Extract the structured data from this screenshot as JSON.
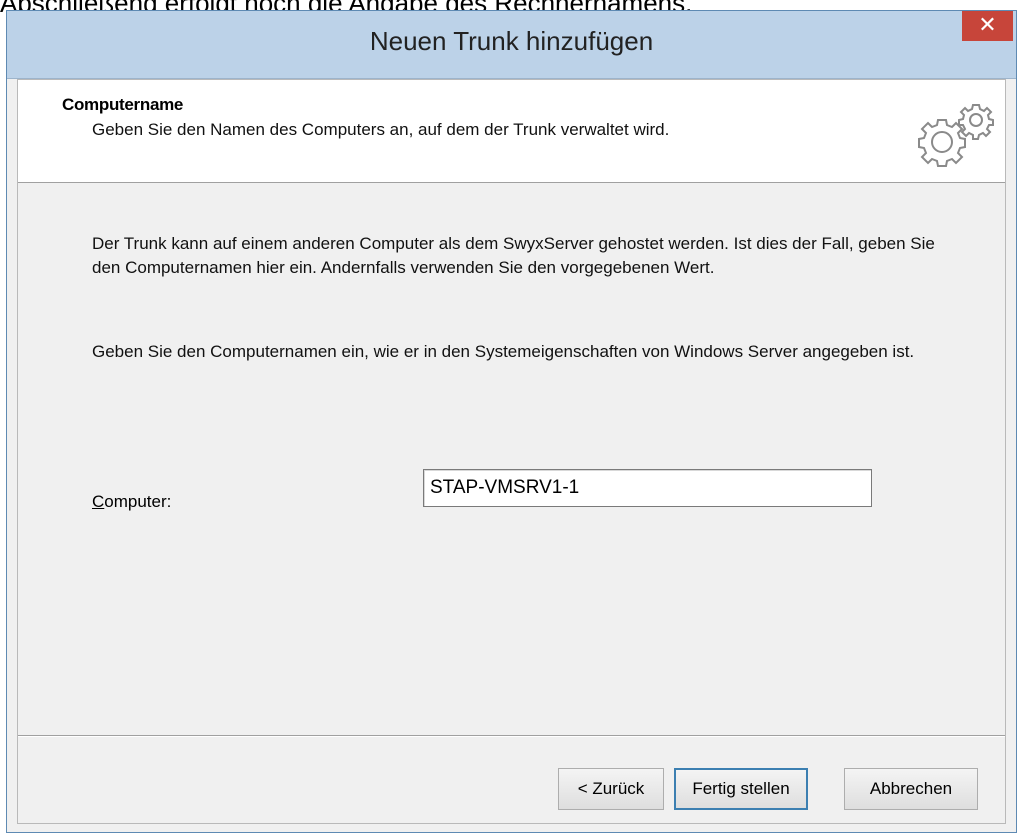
{
  "caption": "Abschließend erfolgt noch die Angabe des Rechnernamens.",
  "window": {
    "title": "Neuen Trunk hinzufügen",
    "close_glyph": "✕"
  },
  "header": {
    "title": "Computername",
    "subtitle": "Geben Sie den Namen des Computers an, auf dem der Trunk verwaltet wird.",
    "icon": "gears-icon"
  },
  "body": {
    "paragraph1": "Der Trunk kann auf einem anderen Computer als dem SwyxServer gehostet werden. Ist dies der Fall, geben Sie den Computernamen hier ein. Andernfalls verwenden Sie den vorgegebenen Wert.",
    "paragraph2": "Geben Sie den Computernamen ein, wie er in den Systemeigenschaften von Windows Server angegeben ist."
  },
  "field": {
    "label_accel": "C",
    "label_rest": "omputer:",
    "value": "STAP-VMSRV1-1"
  },
  "buttons": {
    "back": "< Zurück",
    "finish": "Fertig stellen",
    "cancel": "Abbrechen"
  },
  "colors": {
    "titlebar": "#bcd2e8",
    "close": "#c7453a",
    "default_button_border": "#3c7fb1"
  }
}
